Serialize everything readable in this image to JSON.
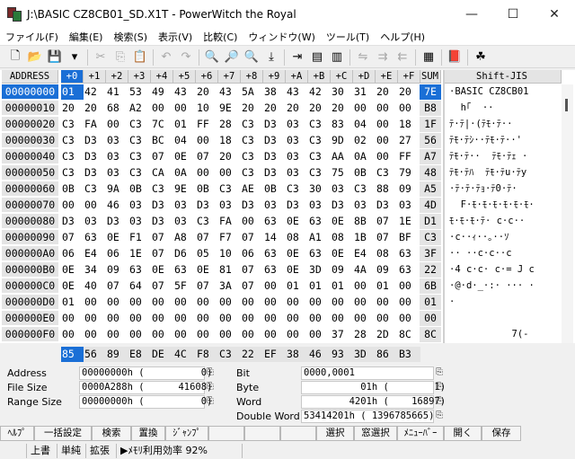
{
  "window": {
    "title": "J:\\BASIC CZ8CB01_SD.X1T - PowerWitch the Royal",
    "min": "—",
    "max": "☐",
    "close": "✕"
  },
  "menu": [
    "ファイル(F)",
    "編集(E)",
    "検索(S)",
    "表示(V)",
    "比較(C)",
    "ウィンドウ(W)",
    "ツール(T)",
    "ヘルプ(H)"
  ],
  "toolbar": [
    {
      "icon": "new-file-icon",
      "glyph": "🗋",
      "enabled": true
    },
    {
      "icon": "open-file-icon",
      "glyph": "📂",
      "enabled": true
    },
    {
      "icon": "save-icon",
      "glyph": "💾",
      "enabled": true
    },
    {
      "icon": "dropdown-icon",
      "glyph": "▾",
      "enabled": true
    },
    {
      "icon": "cut-icon",
      "glyph": "✂",
      "enabled": false
    },
    {
      "icon": "copy-icon",
      "glyph": "⎘",
      "enabled": false
    },
    {
      "icon": "paste-icon",
      "glyph": "📋",
      "enabled": false
    },
    {
      "icon": "undo-icon",
      "glyph": "↶",
      "enabled": false
    },
    {
      "icon": "redo-icon",
      "glyph": "↷",
      "enabled": false
    },
    {
      "icon": "find-icon",
      "glyph": "🔍",
      "enabled": true
    },
    {
      "icon": "find-next-icon",
      "glyph": "🔎",
      "enabled": true
    },
    {
      "icon": "find-prev-icon",
      "glyph": "🔍",
      "enabled": true
    },
    {
      "icon": "jump-icon",
      "glyph": "⤓",
      "enabled": true
    },
    {
      "icon": "insert-icon",
      "glyph": "⇥",
      "enabled": true
    },
    {
      "icon": "bookmark-icon",
      "glyph": "▤",
      "enabled": true
    },
    {
      "icon": "bookmark-next-icon",
      "glyph": "▥",
      "enabled": true
    },
    {
      "icon": "compare-icon",
      "glyph": "⇋",
      "enabled": false
    },
    {
      "icon": "compare-next-icon",
      "glyph": "⇉",
      "enabled": false
    },
    {
      "icon": "compare-prev-icon",
      "glyph": "⇇",
      "enabled": false
    },
    {
      "icon": "calc-icon",
      "glyph": "▦",
      "enabled": true
    },
    {
      "icon": "book-icon",
      "glyph": "📕",
      "enabled": true
    },
    {
      "icon": "witch-icon",
      "glyph": "☘",
      "enabled": true
    }
  ],
  "hex": {
    "address_header": "ADDRESS",
    "col_headers": [
      "+0",
      "+1",
      "+2",
      "+3",
      "+4",
      "+5",
      "+6",
      "+7",
      "+8",
      "+9",
      "+A",
      "+B",
      "+C",
      "+D",
      "+E",
      "+F"
    ],
    "sum_header": "SUM",
    "sjis_header": "Shift-JIS",
    "rows": [
      {
        "addr": "00000000",
        "bytes": [
          "01",
          "42",
          "41",
          "53",
          "49",
          "43",
          "20",
          "43",
          "5A",
          "38",
          "43",
          "42",
          "30",
          "31",
          "20",
          "20"
        ],
        "sum": "7E",
        "text": "·BASIC CZ8CB01"
      },
      {
        "addr": "00000010",
        "bytes": [
          "20",
          "20",
          "68",
          "A2",
          "00",
          "00",
          "10",
          "9E",
          "20",
          "20",
          "20",
          "20",
          "20",
          "00",
          "00",
          "00"
        ],
        "sum": "B8",
        "text": "  h｢  ··"
      },
      {
        "addr": "00000020",
        "bytes": [
          "C3",
          "FA",
          "00",
          "C3",
          "7C",
          "01",
          "FF",
          "28",
          "C3",
          "D3",
          "03",
          "C3",
          "83",
          "04",
          "00",
          "18"
        ],
        "sum": "1F",
        "text": "ﾃ·ﾃ|·(ﾃﾓ·ﾃ··"
      },
      {
        "addr": "00000030",
        "bytes": [
          "C3",
          "D3",
          "03",
          "C3",
          "BC",
          "04",
          "00",
          "18",
          "C3",
          "D3",
          "03",
          "C3",
          "9D",
          "02",
          "00",
          "27"
        ],
        "sum": "56",
        "text": "ﾃﾓ·ﾃｼ··ﾃﾓ·ﾃ··'"
      },
      {
        "addr": "00000040",
        "bytes": [
          "C3",
          "D3",
          "03",
          "C3",
          "07",
          "0E",
          "07",
          "20",
          "C3",
          "D3",
          "03",
          "C3",
          "AA",
          "0A",
          "00",
          "FF"
        ],
        "sum": "A7",
        "text": "ﾃﾓ·ﾃ··  ﾃﾓ·ﾃｪ ·"
      },
      {
        "addr": "00000050",
        "bytes": [
          "C3",
          "D3",
          "03",
          "C3",
          "CA",
          "0A",
          "00",
          "00",
          "C3",
          "D3",
          "03",
          "C3",
          "75",
          "0B",
          "C3",
          "79"
        ],
        "sum": "48",
        "text": "ﾃﾓ·ﾃﾊ  ﾃﾓ·ﾃu·ﾃy"
      },
      {
        "addr": "00000060",
        "bytes": [
          "0B",
          "C3",
          "9A",
          "0B",
          "C3",
          "9E",
          "0B",
          "C3",
          "AE",
          "0B",
          "C3",
          "30",
          "03",
          "C3",
          "88",
          "09"
        ],
        "sum": "A5",
        "text": "·ﾃ·ﾃ·ﾃｮ·ﾃ0·ﾃ·"
      },
      {
        "addr": "00000070",
        "bytes": [
          "00",
          "00",
          "46",
          "03",
          "D3",
          "03",
          "D3",
          "03",
          "D3",
          "03",
          "D3",
          "03",
          "D3",
          "03",
          "D3",
          "03"
        ],
        "sum": "4D",
        "text": "  F·ﾓ·ﾓ·ﾓ·ﾓ·ﾓ·ﾓ·"
      },
      {
        "addr": "00000080",
        "bytes": [
          "D3",
          "03",
          "D3",
          "03",
          "D3",
          "03",
          "C3",
          "FA",
          "00",
          "63",
          "0E",
          "63",
          "0E",
          "8B",
          "07",
          "1E"
        ],
        "sum": "D1",
        "text": "ﾓ·ﾓ·ﾓ·ﾃ· c·c··"
      },
      {
        "addr": "00000090",
        "bytes": [
          "07",
          "63",
          "0E",
          "F1",
          "07",
          "A8",
          "07",
          "F7",
          "07",
          "14",
          "08",
          "A1",
          "08",
          "1B",
          "07",
          "BF"
        ],
        "sum": "C3",
        "text": "·c··ｨ··｡··ｿ"
      },
      {
        "addr": "000000A0",
        "bytes": [
          "06",
          "E4",
          "06",
          "1E",
          "07",
          "D6",
          "05",
          "10",
          "06",
          "63",
          "0E",
          "63",
          "0E",
          "E4",
          "08",
          "63"
        ],
        "sum": "3F",
        "text": "·· ··c·c··c"
      },
      {
        "addr": "000000B0",
        "bytes": [
          "0E",
          "34",
          "09",
          "63",
          "0E",
          "63",
          "0E",
          "81",
          "07",
          "63",
          "0E",
          "3D",
          "09",
          "4A",
          "09",
          "63"
        ],
        "sum": "22",
        "text": "·4 c·c· c·= J c"
      },
      {
        "addr": "000000C0",
        "bytes": [
          "0E",
          "40",
          "07",
          "64",
          "07",
          "5F",
          "07",
          "3A",
          "07",
          "00",
          "01",
          "01",
          "01",
          "00",
          "01",
          "00"
        ],
        "sum": "6B",
        "text": "·@·d·_·:· ··· ·"
      },
      {
        "addr": "000000D0",
        "bytes": [
          "01",
          "00",
          "00",
          "00",
          "00",
          "00",
          "00",
          "00",
          "00",
          "00",
          "00",
          "00",
          "00",
          "00",
          "00",
          "00"
        ],
        "sum": "01",
        "text": "·"
      },
      {
        "addr": "000000E0",
        "bytes": [
          "00",
          "00",
          "00",
          "00",
          "00",
          "00",
          "00",
          "00",
          "00",
          "00",
          "00",
          "00",
          "00",
          "00",
          "00",
          "00"
        ],
        "sum": "00",
        "text": ""
      },
      {
        "addr": "000000F0",
        "bytes": [
          "00",
          "00",
          "00",
          "00",
          "00",
          "00",
          "00",
          "00",
          "00",
          "00",
          "00",
          "00",
          "37",
          "28",
          "2D",
          "8C"
        ],
        "sum": "8C",
        "text": "           7(-"
      }
    ],
    "col_sums": [
      "85",
      "56",
      "89",
      "E8",
      "DE",
      "4C",
      "F8",
      "C3",
      "22",
      "EF",
      "38",
      "46",
      "93",
      "3D",
      "86",
      "B3"
    ]
  },
  "info": {
    "address": {
      "label": "Address",
      "value": "00000000h (          0)"
    },
    "file_size": {
      "label": "File Size",
      "value": "0000A288h (      41608)"
    },
    "range_size": {
      "label": "Range Size",
      "value": "00000000h (          0)"
    },
    "bit": {
      "label": "Bit",
      "value": "0000,0001"
    },
    "byte": {
      "label": "Byte",
      "value": "          01h (        1)"
    },
    "word": {
      "label": "Word",
      "value": "        4201h (    16897)"
    },
    "dword": {
      "label": "Double Word",
      "value": "53414201h ( 1396785665)"
    }
  },
  "funckeys": [
    "ﾍﾙﾌﾟ",
    "一括設定",
    "検索",
    "置換",
    "ｼﾞｬﾝﾌﾟ",
    "",
    "",
    "",
    "選択",
    "窓選択",
    "ﾒﾆｭｰﾊﾞｰ",
    "開く",
    "保存"
  ],
  "status": [
    "",
    "上書",
    "単純",
    "拡張",
    "▶ﾒﾓﾘ利用効率 92%"
  ]
}
